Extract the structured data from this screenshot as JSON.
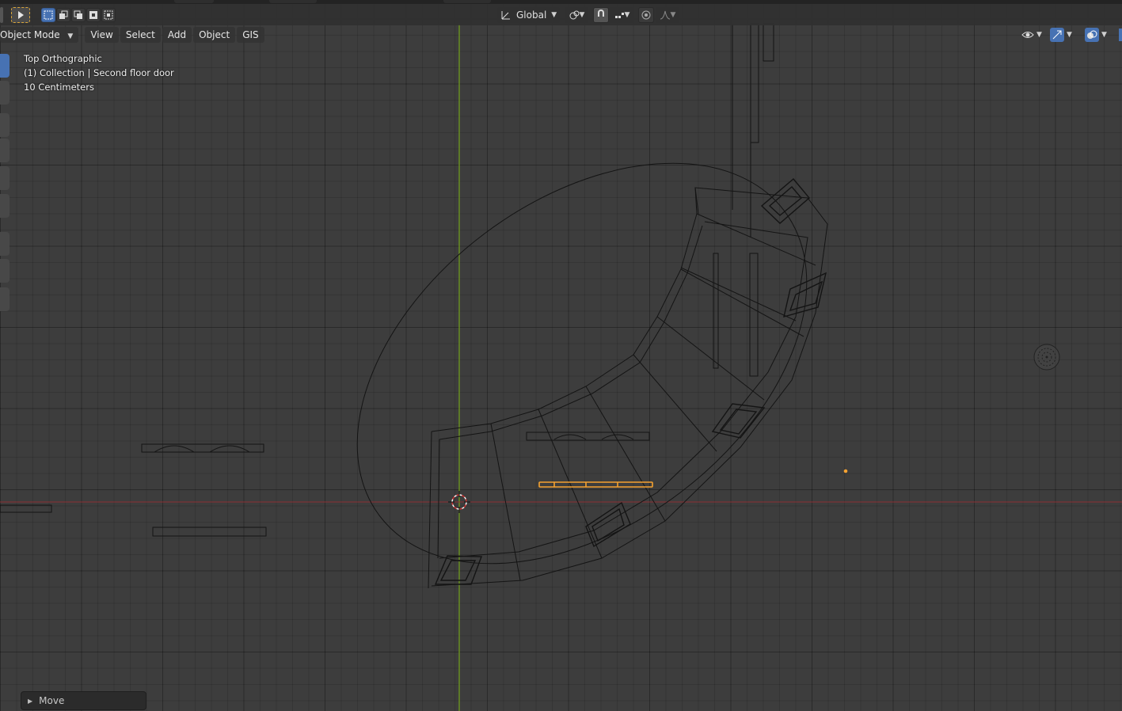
{
  "header": {
    "orientation_label": "Global"
  },
  "menu": {
    "mode": "Object Mode",
    "items": [
      "View",
      "Select",
      "Add",
      "Object",
      "GIS"
    ]
  },
  "viewport_info": {
    "view_name": "Top Orthographic",
    "active_object": "(1) Collection | Second floor door",
    "scale": "10 Centimeters"
  },
  "last_operator": {
    "label": "Move"
  },
  "colors": {
    "background": "#3d3d3d",
    "wireframe": "#111111",
    "selected": "#f5a231",
    "x_axis": "#8b2e33",
    "y_axis": "#6f9a1d",
    "accent": "#4772b3"
  },
  "icons": [
    "select-box-icon",
    "orientation-icon",
    "pivot-icon",
    "snap-magnet-icon",
    "snap-increment-icon",
    "proportional-edit-icon",
    "falloff-icon",
    "visibility-icon",
    "gizmo-icon",
    "overlay-icon",
    "navigation-gizmo-icon",
    "3d-cursor-icon"
  ]
}
